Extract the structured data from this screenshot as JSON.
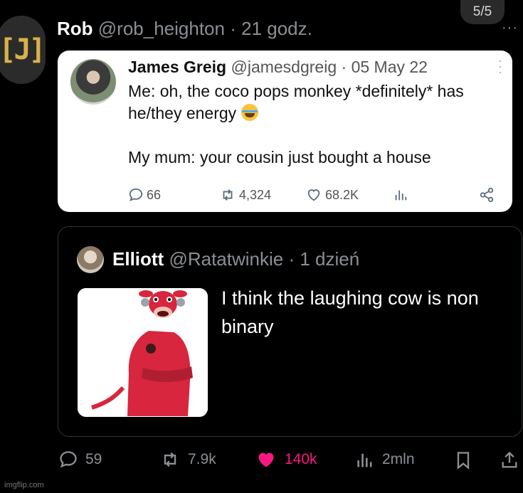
{
  "page_counter": "5/5",
  "outer_tweet": {
    "author_name": "Rob",
    "author_handle": "@rob_heighton",
    "time": "· 21 godz.",
    "more": "···"
  },
  "embedded_tweet": {
    "author_name": "James Greig",
    "author_handle": "@jamesdgreig",
    "time": "· 05 May 22",
    "line1": "Me: oh, the coco pops monkey *definitely* has he/they energy",
    "line2": "My mum: your cousin just bought a house",
    "replies": "66",
    "retweets": "4,324",
    "likes": "68.2K"
  },
  "quoted_tweet": {
    "author_name": "Elliott",
    "author_handle": "@Ratatwinkie",
    "time": "· 1 dzień",
    "text": "I think the laughing cow is non binary",
    "image_name": "red-laughing-cow-cartoon"
  },
  "actions": {
    "replies": "59",
    "retweets": "7.9k",
    "likes": "140k",
    "views": "2mln"
  },
  "watermark": "imgflip.com",
  "colors": {
    "like": "#f91880",
    "muted": "#8b8f94",
    "background": "#000000"
  }
}
